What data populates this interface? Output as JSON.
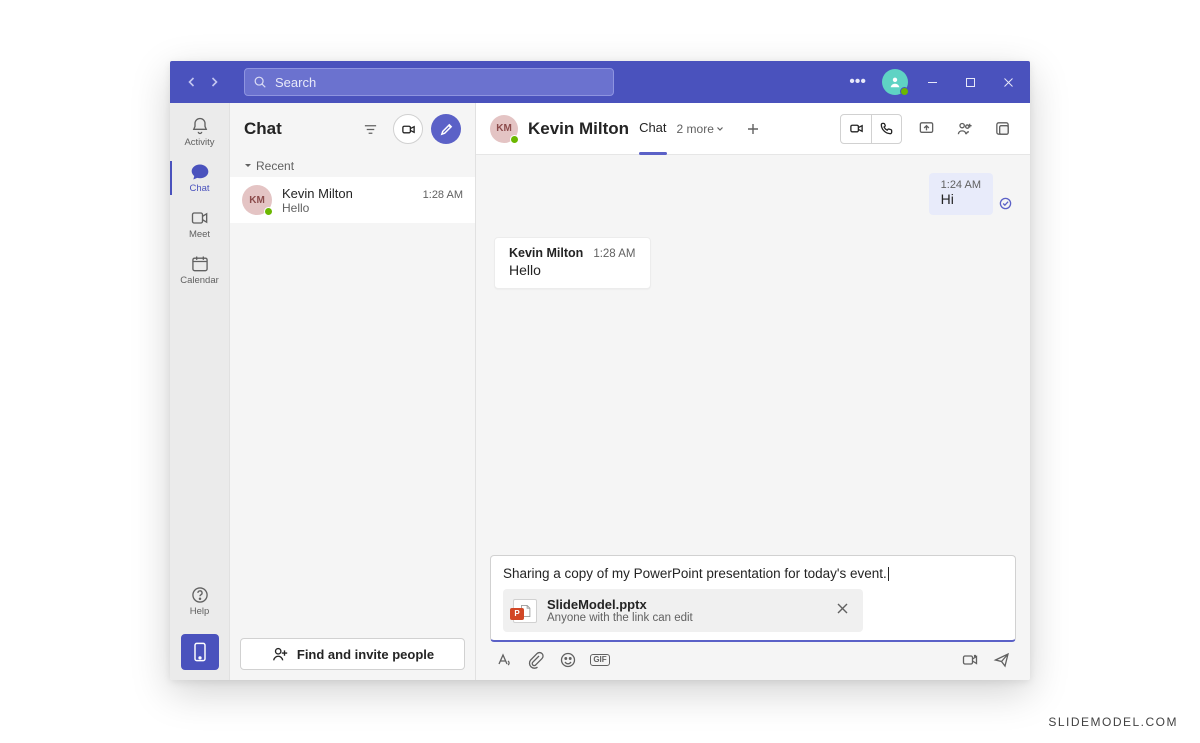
{
  "titlebar": {
    "search_placeholder": "Search"
  },
  "rail": {
    "activity": "Activity",
    "chat": "Chat",
    "meet": "Meet",
    "calendar": "Calendar",
    "help": "Help"
  },
  "chatlist": {
    "title": "Chat",
    "section_recent": "Recent",
    "entry": {
      "initials": "KM",
      "name": "Kevin Milton",
      "preview": "Hello",
      "time": "1:28 AM"
    },
    "find_invite": "Find and invite people"
  },
  "convo": {
    "avatar_initials": "KM",
    "title": "Kevin Milton",
    "tab_chat": "Chat",
    "more_label": "2 more",
    "messages": {
      "out": {
        "time": "1:24 AM",
        "text": "Hi"
      },
      "in": {
        "name": "Kevin Milton",
        "time": "1:28 AM",
        "text": "Hello"
      }
    }
  },
  "composer": {
    "text": "Sharing a copy of my PowerPoint presentation for today's event.",
    "attachment": {
      "name": "SlideModel.pptx",
      "permission": "Anyone with the link can edit",
      "badge": "P"
    },
    "gif_label": "GIF"
  },
  "watermark": "SLIDEMODEL.COM"
}
